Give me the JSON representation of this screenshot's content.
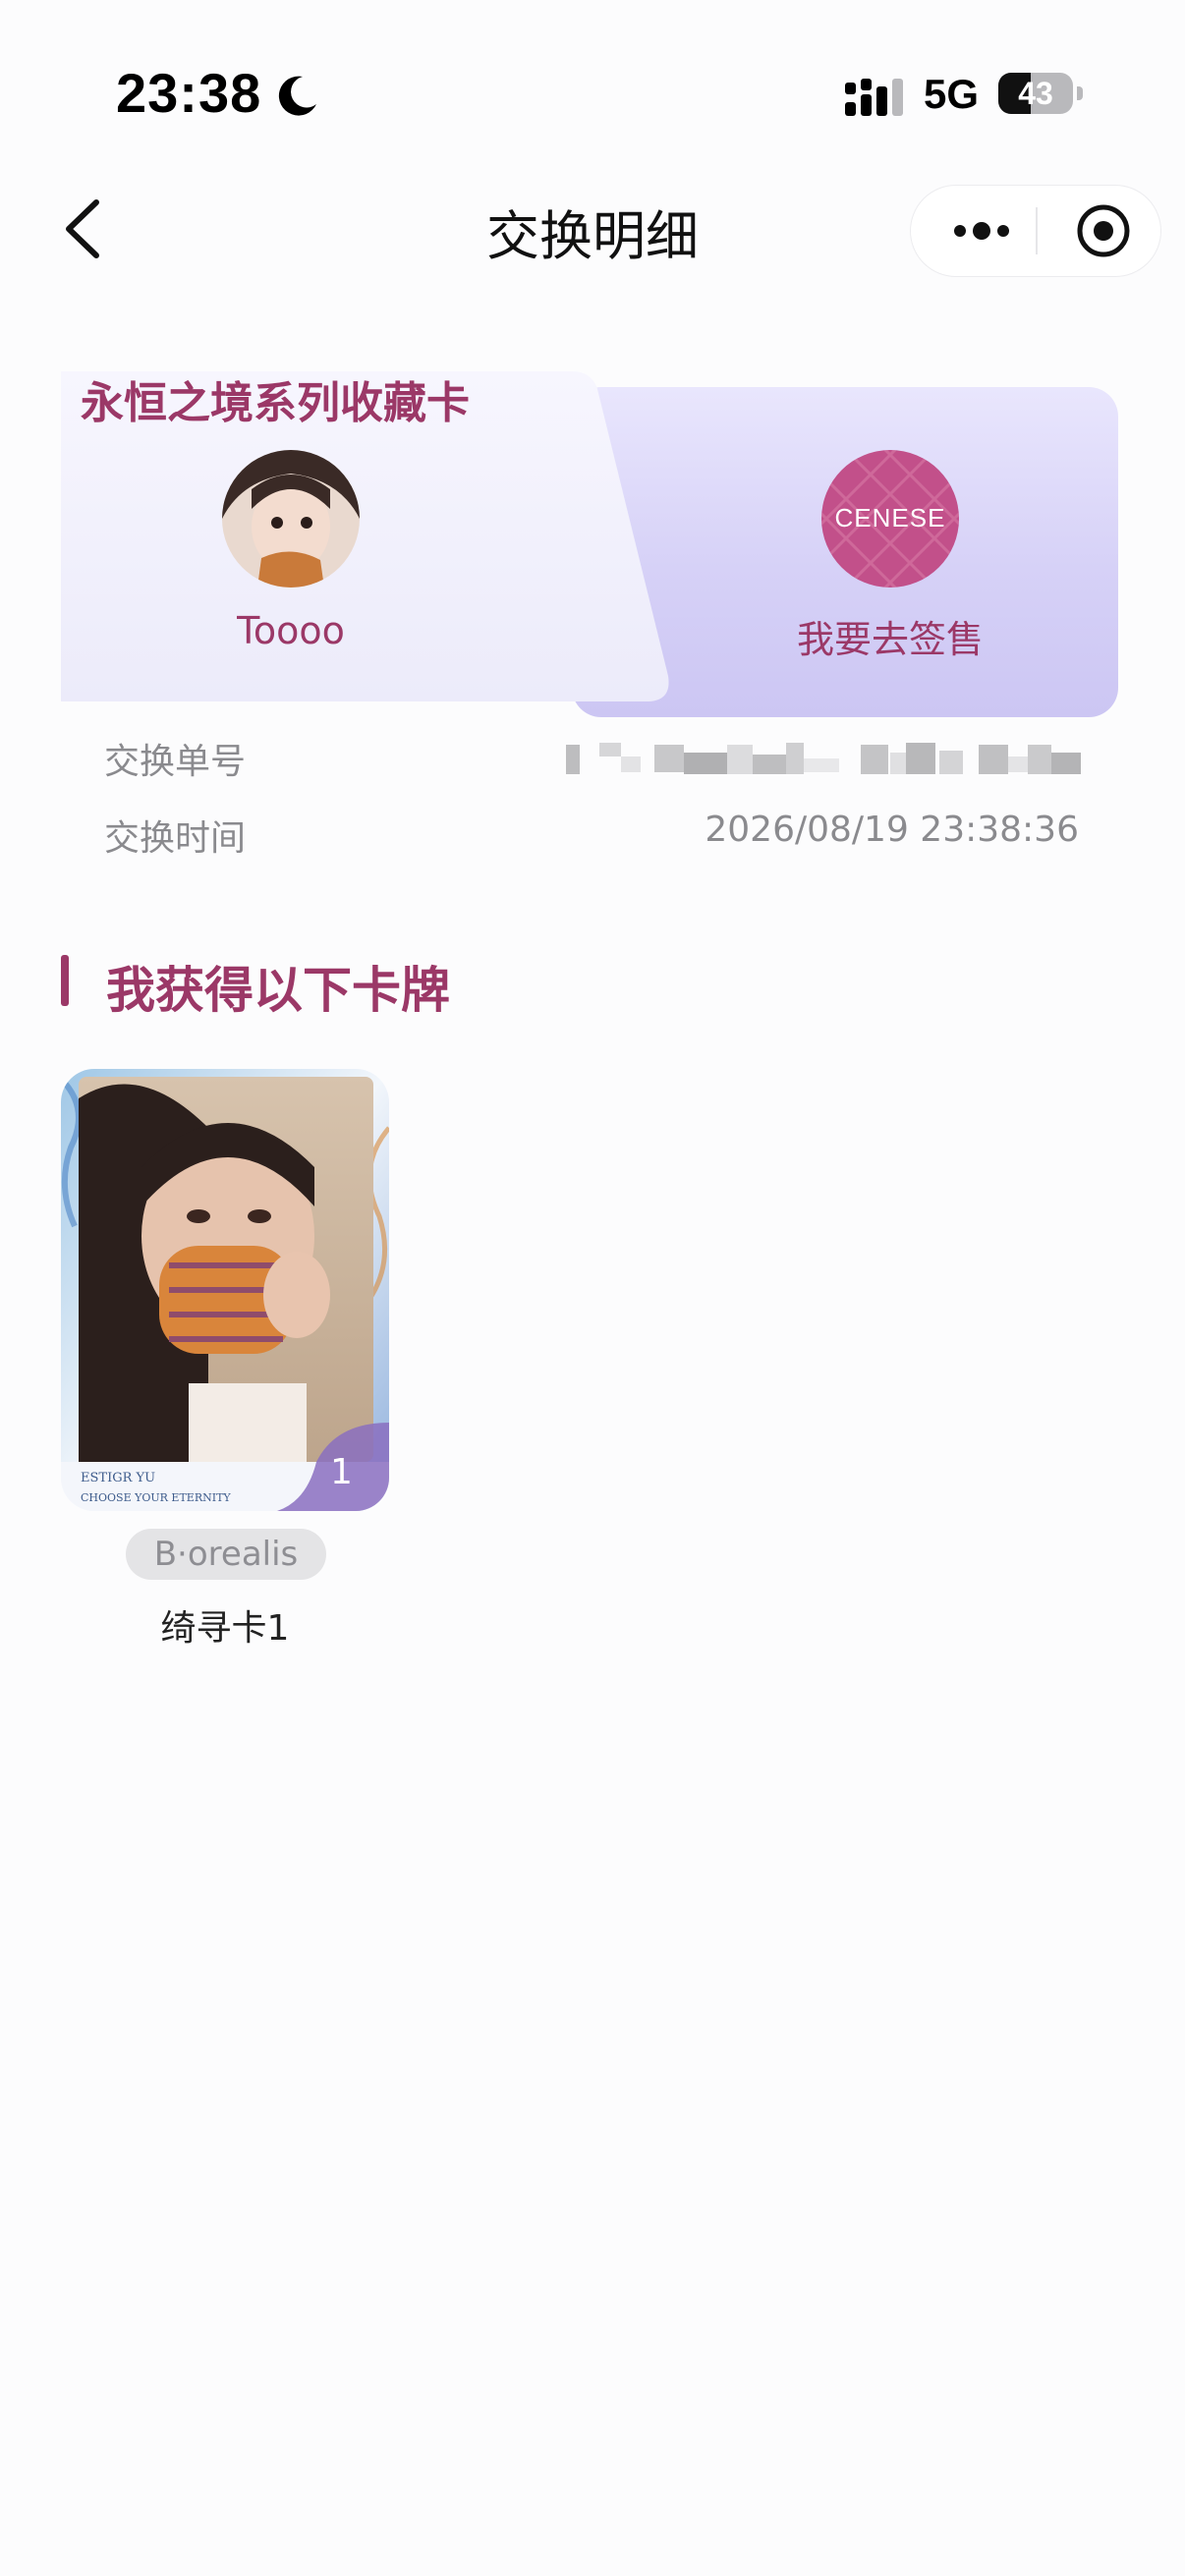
{
  "status_bar": {
    "time": "23:38",
    "network": "5G",
    "battery": "43",
    "battery_level": 0.43
  },
  "nav": {
    "title": "交换明细",
    "back_icon": "chevron-left-icon",
    "more_icon": "more-dots-icon",
    "close_icon": "target-icon"
  },
  "exchange": {
    "series_name": "永恒之境系列收藏卡",
    "from_user": "Toooo",
    "to_brand_logo": "CENESE",
    "to_action": "我要去签售",
    "order_no_label": "交换单号",
    "order_no_value": "",
    "time_label": "交换时间",
    "time_value": "2026/08/19 23:38:36"
  },
  "received_section": {
    "title": "我获得以下卡牌",
    "cards": [
      {
        "count": "1",
        "tag": "B·orealis",
        "name": "绮寻卡1",
        "card_text_line1": "ESTIGR YU",
        "card_text_line2": "CHOOSE YOUR ETERNITY"
      }
    ]
  },
  "colors": {
    "accent": "#9b3867",
    "panel_lavender": "#d6d1f7",
    "brand_circle": "#c2508a",
    "muted_text": "#8a8a8e"
  }
}
